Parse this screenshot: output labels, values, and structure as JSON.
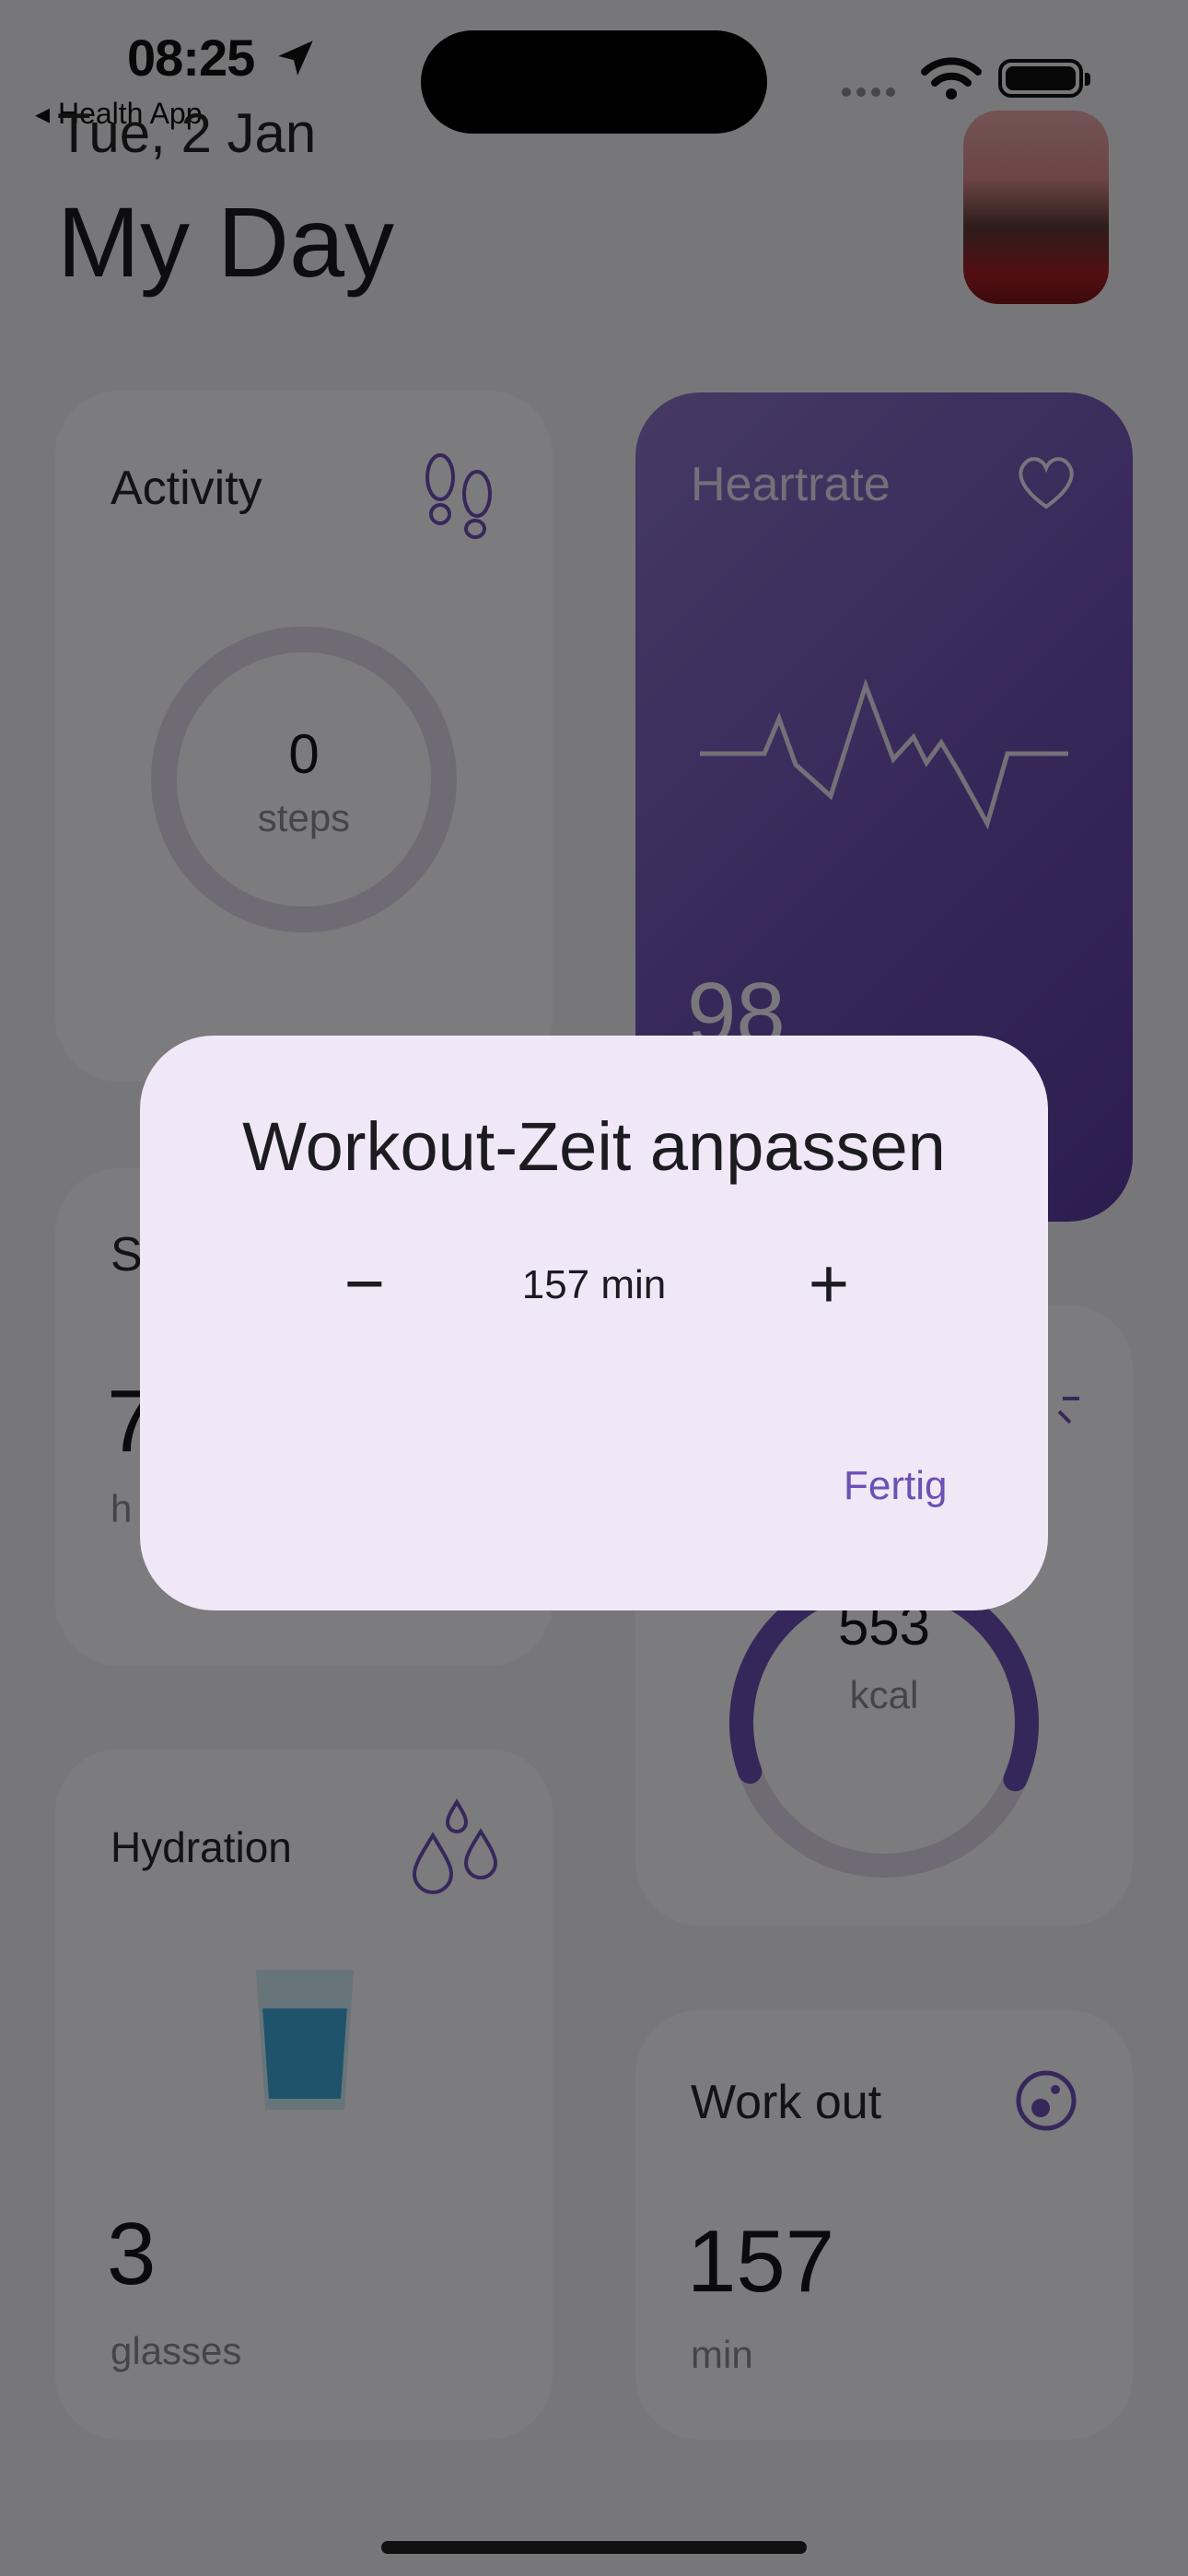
{
  "status": {
    "time": "08:25",
    "back_label": "◂ Health App"
  },
  "header": {
    "date": "Tue, 2 Jan",
    "title": "My Day"
  },
  "cards": {
    "activity": {
      "title": "Activity",
      "value": "0",
      "unit": "steps"
    },
    "heartrate": {
      "title": "Heartrate",
      "value": "98"
    },
    "sleep": {
      "title_letter": "S",
      "value": "7",
      "unit_partial": "h"
    },
    "calories": {
      "value": "553",
      "unit": "kcal",
      "progress": 0.62
    },
    "hydration": {
      "title": "Hydration",
      "value": "3",
      "unit": "glasses",
      "glass_fill": 0.7
    },
    "workout": {
      "title": "Work out",
      "value": "157",
      "unit": "min"
    }
  },
  "dialog": {
    "title": "Workout-Zeit anpassen",
    "minus_label": "−",
    "value": "157 min",
    "plus_label": "+",
    "done_label": "Fertig"
  },
  "colors": {
    "accent": "#6c50b6",
    "heart_card": "#6d4fb3",
    "dialog_bg": "#f0e7f7"
  },
  "icons": [
    "location-arrow-icon",
    "wifi-icon",
    "battery-icon",
    "footprints-icon",
    "heart-icon",
    "heartbeat-line-icon",
    "sun-icon",
    "drops-icon",
    "glass-icon",
    "workout-icon"
  ]
}
